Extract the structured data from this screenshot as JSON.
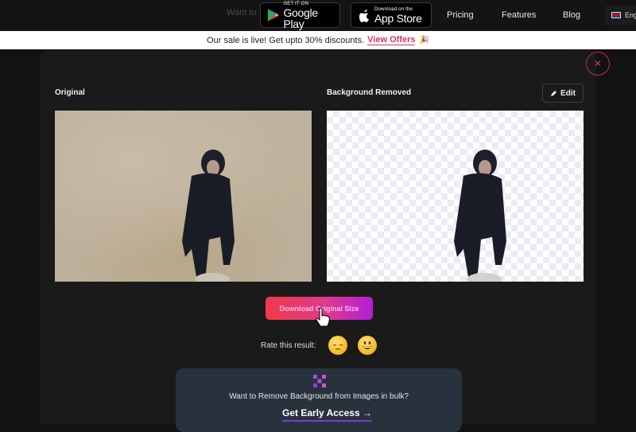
{
  "header": {
    "ghost_text": "Want to",
    "google_play": {
      "small": "GET IT ON",
      "big": "Google Play"
    },
    "app_store": {
      "small": "Download on the",
      "big": "App Store"
    },
    "nav": [
      "Pricing",
      "Features",
      "Blog"
    ],
    "language": "Eng",
    "language_flag_icon": "uk-flag-icon"
  },
  "sale_banner": {
    "text": "Our sale is live! Get upto 30% discounts.",
    "link": "View Offers",
    "emoji": "🎉"
  },
  "modal": {
    "close_icon": "close-icon",
    "original_label": "Original",
    "removed_label": "Background Removed",
    "edit_label": "Edit",
    "edit_icon": "pencil-icon",
    "download_label": "Download Original Size",
    "rate_label": "Rate this result:",
    "rate_options": [
      "sad-face-icon",
      "happy-face-icon"
    ]
  },
  "bulk_promo": {
    "question": "Want to Remove Background from Images in bulk?",
    "cta": "Get Early Access →"
  },
  "colors": {
    "accent_pink": "#d6336c",
    "gradient_start": "#f03a4a",
    "gradient_end": "#b21fd6",
    "promo_bg": "#27323d"
  }
}
